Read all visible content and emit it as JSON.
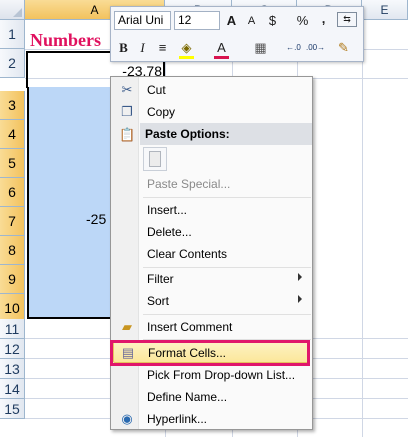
{
  "sheet": {
    "columns": [
      "A",
      "B",
      "C",
      "D",
      "E"
    ],
    "rows": [
      "1",
      "2",
      "3",
      "4",
      "5",
      "6",
      "7",
      "8",
      "9",
      "10",
      "11",
      "12",
      "13",
      "14",
      "15"
    ],
    "cells": {
      "A1": "Numbers",
      "A2": "-23.78",
      "A7": "-25"
    }
  },
  "minibar": {
    "font_name": "Arial Uni",
    "font_size": "12",
    "buttons": {
      "grow_font": "A",
      "shrink_font": "A",
      "currency": "$",
      "percent": "%",
      "comma": ",",
      "bold": "B",
      "italic": "I",
      "center": "≡",
      "font_color": "A",
      "decimals_inc": "⁰⁰",
      "decimals_dec": "⁰⁰"
    }
  },
  "menu": {
    "cut": "Cut",
    "copy": "Copy",
    "paste_options": "Paste Options:",
    "paste_special": "Paste Special...",
    "insert": "Insert...",
    "delete": "Delete...",
    "clear_contents": "Clear Contents",
    "filter": "Filter",
    "sort": "Sort",
    "insert_comment": "Insert Comment",
    "format_cells": "Format Cells...",
    "pick_from_list": "Pick From Drop-down List...",
    "define_name": "Define Name...",
    "hyperlink": "Hyperlink..."
  },
  "colors": {
    "highlight_frame": "#e0166b",
    "title_text": "#e0105e",
    "selection_fill": "#bcd7f7"
  }
}
